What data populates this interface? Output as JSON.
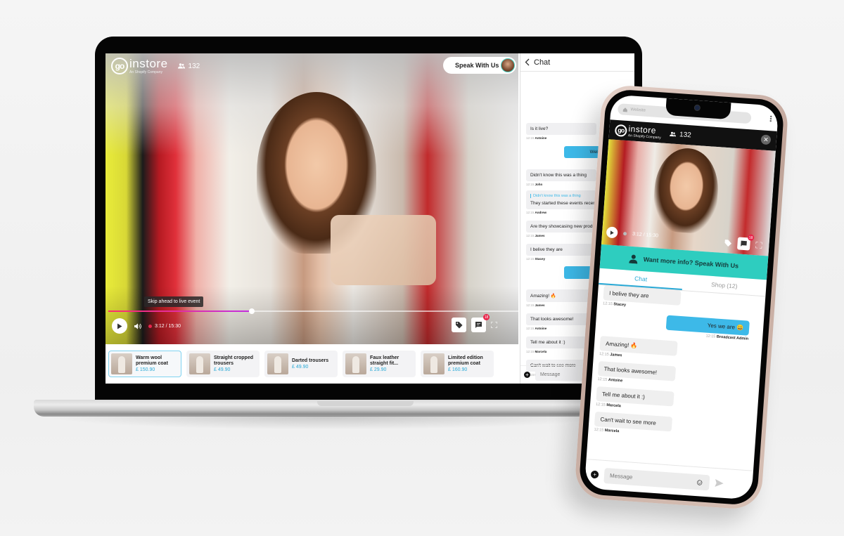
{
  "brand": {
    "logo_mark": "go",
    "logo_text": "instore",
    "logo_sub": "An Shopify Company"
  },
  "stream": {
    "viewer_count": "132",
    "speak_button": "Speak With Us",
    "tooltip": "Skip ahead to live event",
    "progress_percent": 35,
    "time": "3:12 / 15:30",
    "chat_badge": "18"
  },
  "products": [
    {
      "name": "Warm wool premium coat",
      "price": "£ 150.90",
      "active": true
    },
    {
      "name": "Straight cropped trousers",
      "price": "£ 49.90"
    },
    {
      "name": "Darted trousers",
      "price": "£ 49.90"
    },
    {
      "name": "Faux leather straight fit...",
      "price": "£ 29.90"
    },
    {
      "name": "Limited edition premium coat",
      "price": "£ 160.90"
    }
  ],
  "chat": {
    "title": "Chat",
    "input_placeholder": "Message",
    "messages": [
      {
        "text": "Is it live?",
        "time": "12:15",
        "author": "Antoine"
      },
      {
        "text": "Welcome everyone!",
        "time": "12:15",
        "author": "Broadcast Admin",
        "own": true
      },
      {
        "text": "Didn't know this was a thing",
        "time": "12:15",
        "author": "John"
      },
      {
        "quote": "Didn't know this was a thing",
        "text": "They started these events recently",
        "time": "12:15",
        "author": "Andrew"
      },
      {
        "text": "Are they showcasing new products?",
        "time": "12:15",
        "author": "James"
      },
      {
        "text": "I belive they are",
        "time": "12:15",
        "author": "Stacey"
      },
      {
        "text": "Yes we are 😀",
        "time": "12:15",
        "author": "Broadcast Admin",
        "own": true
      },
      {
        "text": "Amazing! 🔥",
        "time": "12:15",
        "author": "James"
      },
      {
        "text": "That looks awesome!",
        "time": "12:15",
        "author": "Antoine"
      },
      {
        "text": "Tell me about it :)",
        "time": "12:15",
        "author": "Marcela"
      },
      {
        "text": "Can't wait to see more",
        "time": "12:15",
        "author": "Marcela"
      }
    ]
  },
  "mobile": {
    "url_placeholder": "Website",
    "viewer_count": "132",
    "time": "3:12 / 15:30",
    "chat_badge": "18",
    "speak_banner": "Want more info? Speak With Us",
    "tabs": [
      {
        "label": "Chat",
        "active": true
      },
      {
        "label": "Shop (12)"
      }
    ],
    "input_placeholder": "Message",
    "messages": [
      {
        "text": "I belive they are",
        "time": "12:15",
        "author": "Stacey"
      },
      {
        "text": "Yes we are 😀",
        "time": "12:15",
        "author": "Broadcast Admin",
        "own": true
      },
      {
        "text": "Amazing! 🔥",
        "time": "12:15",
        "author": "James"
      },
      {
        "text": "That looks awesome!",
        "time": "12:15",
        "author": "Antoine"
      },
      {
        "text": "Tell me about it :)",
        "time": "12:15",
        "author": "Marcela"
      },
      {
        "text": "Can't wait to see more",
        "time": "12:15",
        "author": "Marcela"
      }
    ]
  }
}
